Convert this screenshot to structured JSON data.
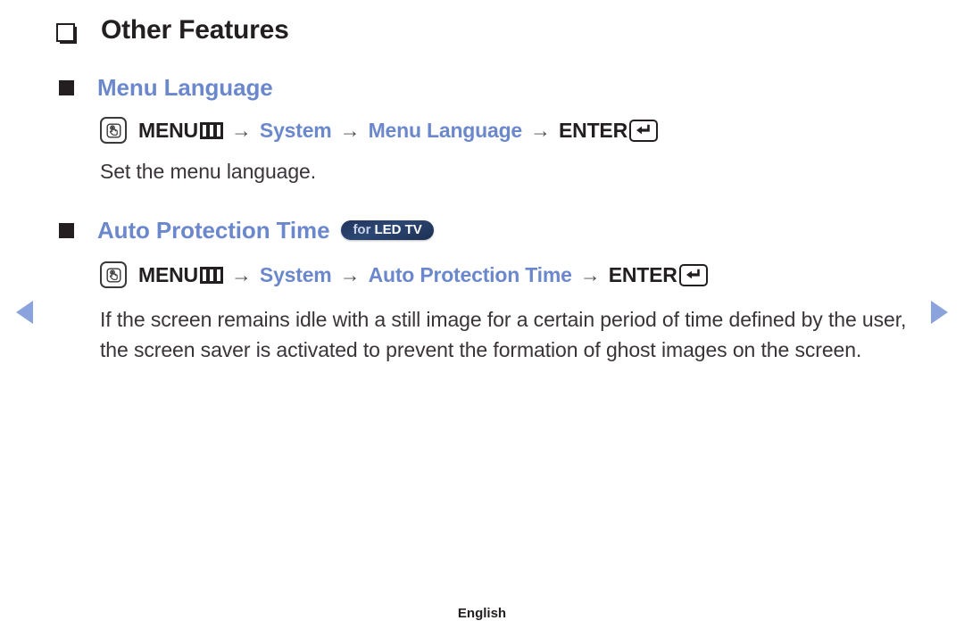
{
  "page": {
    "title": "Other Features",
    "footer_label": "English",
    "accent_blue": "#6c88cc",
    "text_color": "#231f20",
    "badge_color": "#22345e",
    "nav_arrow_color": "#8ba3dc"
  },
  "nav": {
    "prev_label": "Previous page",
    "next_label": "Next page"
  },
  "sections": [
    {
      "heading": "Menu Language",
      "badge": null,
      "path": {
        "button_icon": "press-button-icon",
        "menu_label": "MENU",
        "menu_icon": "menu-bars-icon",
        "arrow": "→",
        "steps": [
          "System",
          "Menu Language"
        ],
        "enter_label": "ENTER",
        "enter_icon": "enter-key-icon"
      },
      "body": "Set the menu language."
    },
    {
      "heading": "Auto Protection Time",
      "badge": {
        "prefix": "for",
        "model": "LED TV"
      },
      "path": {
        "button_icon": "press-button-icon",
        "menu_label": "MENU",
        "menu_icon": "menu-bars-icon",
        "arrow": "→",
        "steps": [
          "System",
          "Auto Protection Time"
        ],
        "enter_label": "ENTER",
        "enter_icon": "enter-key-icon"
      },
      "body": "If the screen remains idle with a still image for a certain period of time defined by the user, the screen saver is activated to prevent the formation of ghost images on the screen."
    }
  ]
}
